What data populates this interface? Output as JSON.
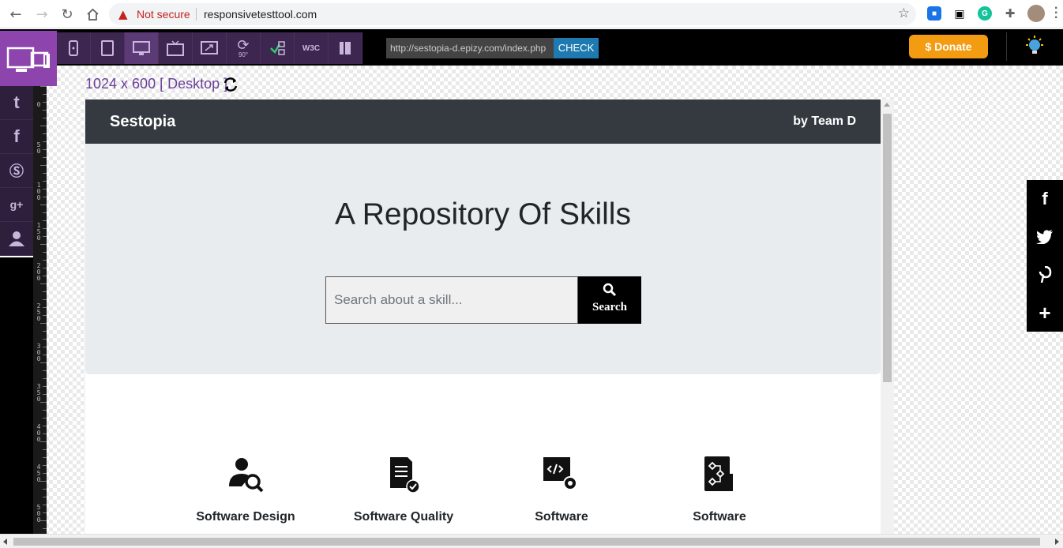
{
  "browser": {
    "security_label": "Not secure",
    "url": "responsivetesttool.com"
  },
  "tool": {
    "url_field_value": "http://sestopia-d.epizy.com/index.php",
    "check_label": "CHECK",
    "donate_label": "$ Donate",
    "w3c_label": "W3C",
    "rotate_label": "90°",
    "dimension_label": "1024 x 600 [ Desktop ]",
    "ruler_labels": [
      "0",
      "50",
      "100",
      "150",
      "200",
      "250",
      "300",
      "350",
      "400",
      "450",
      "500"
    ]
  },
  "site": {
    "brand": "Sestopia",
    "by_line": "by Team D",
    "hero_title": "A Repository Of Skills",
    "search_placeholder": "Search about a skill...",
    "search_button": "Search",
    "skills": [
      {
        "label": "Software Design"
      },
      {
        "label": "Software Quality"
      },
      {
        "label": "Software"
      },
      {
        "label": "Software"
      }
    ]
  },
  "colors": {
    "accent_purple": "#8e44ad",
    "check_blue": "#1e7ab0",
    "donate_orange": "#f39c12",
    "nav_dark": "#343a40",
    "jumbotron": "#e9ecef"
  }
}
